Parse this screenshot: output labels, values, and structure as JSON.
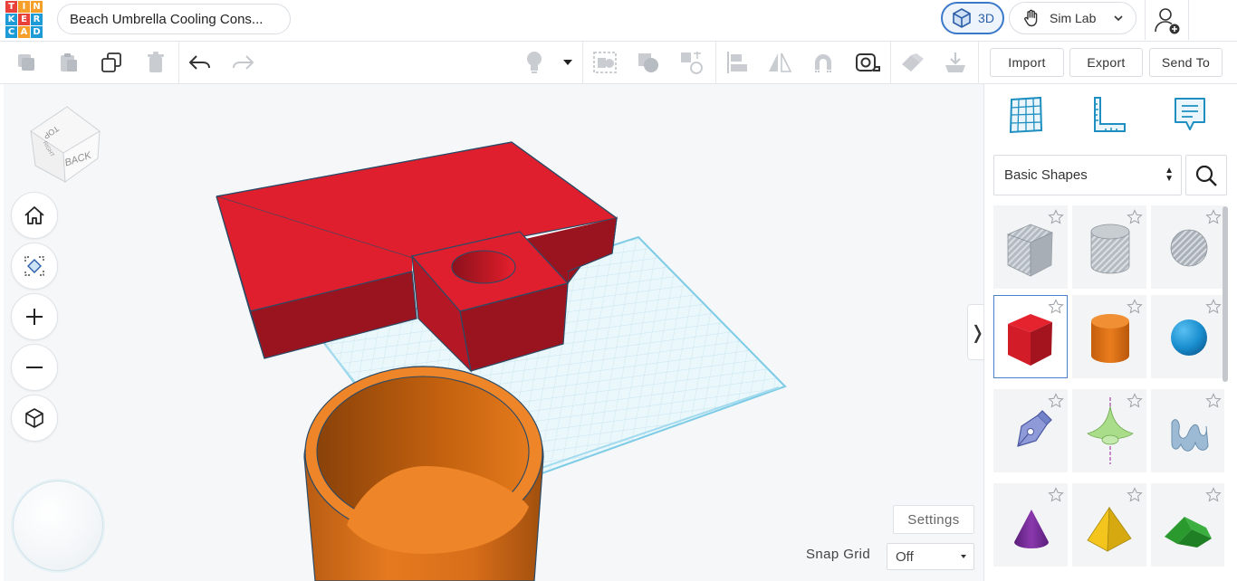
{
  "logo": {
    "letters": [
      "T",
      "I",
      "N",
      "K",
      "E",
      "R",
      "C",
      "A",
      "D"
    ]
  },
  "header": {
    "design_title": "Beach Umbrella Cooling Cons...",
    "view3d_label": "3D",
    "simlab_label": "Sim Lab"
  },
  "toolbar": {
    "buttons": [
      "copy",
      "paste",
      "duplicate",
      "delete",
      "undo",
      "redo",
      "show-all",
      "notes-dropdown",
      "group",
      "ungroup",
      "workplane",
      "align",
      "mirror",
      "cruise",
      "ruler",
      "measure",
      "import-3d"
    ],
    "import_label": "Import",
    "export_label": "Export",
    "send_to_label": "Send To"
  },
  "viewcube": {
    "top_label": "TOP",
    "back_label": "BACK",
    "right_label": "RIGHT"
  },
  "nav_buttons": [
    "home-view",
    "fit-all",
    "zoom-in",
    "zoom-out",
    "perspective"
  ],
  "workplane": {
    "settings_label": "Settings",
    "snap_grid_label": "Snap Grid",
    "snap_grid_value": "Off"
  },
  "panel": {
    "shape_category": "Basic Shapes",
    "shapes": [
      {
        "name": "box-hole",
        "color": "#9aa3ad"
      },
      {
        "name": "cylinder-hole",
        "color": "#aeb5bc"
      },
      {
        "name": "sphere-hole",
        "color": "#a9b0b8"
      },
      {
        "name": "box",
        "color": "#d91f2a",
        "selected": true
      },
      {
        "name": "cylinder",
        "color": "#e67817"
      },
      {
        "name": "sphere",
        "color": "#1a8fd0"
      },
      {
        "name": "scribble",
        "color": "#7f8fd4"
      },
      {
        "name": "paraboloid",
        "color": "#a8d98c"
      },
      {
        "name": "text-shape",
        "color": "#9bb6cf"
      },
      {
        "name": "cone",
        "color": "#7e2fa0"
      },
      {
        "name": "pyramid",
        "color": "#f1c21b"
      },
      {
        "name": "roof",
        "color": "#2fa233"
      }
    ]
  },
  "colors": {
    "accent": "#3a78c9",
    "box_red": "#de1f2c",
    "box_red_dark": "#9b1420",
    "cylinder_orange": "#ec7f22",
    "workplane_grid": "#6cc4e2"
  }
}
